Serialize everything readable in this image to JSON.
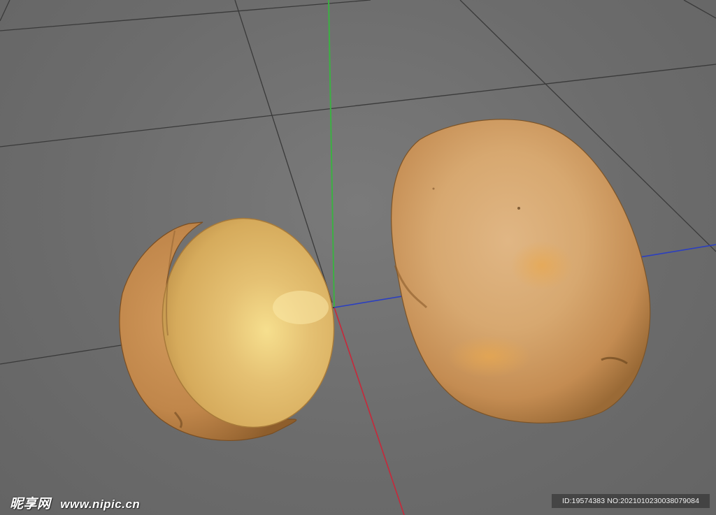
{
  "viewport": {
    "background_color": "#6e6e6e",
    "grid_line_color": "#3a3a3a",
    "axis_colors": {
      "y_axis": "#3cb043",
      "x_axis": "#c8283a",
      "z_axis": "#2b3fc0"
    }
  },
  "objects": [
    {
      "name": "Half-cut potato",
      "icon": "potato-half-icon"
    },
    {
      "name": "Whole potato",
      "icon": "potato-whole-icon"
    }
  ],
  "watermark": {
    "brand": "昵享网",
    "url": "www.nipic.cn",
    "id_text": "ID:19574383 NO:20210102300380790​84"
  }
}
